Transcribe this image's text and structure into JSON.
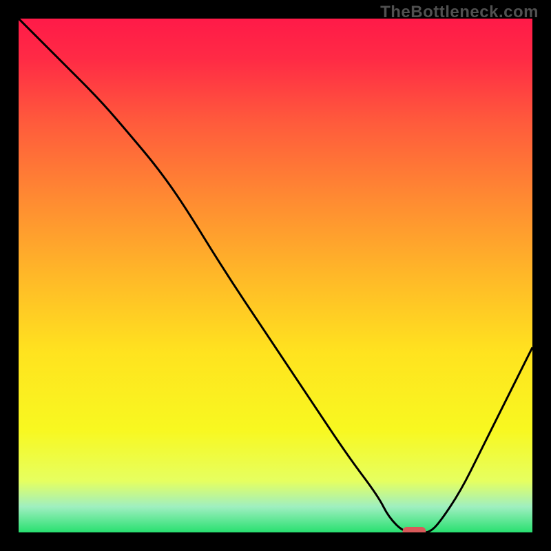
{
  "watermark": "TheBottleneck.com",
  "chart_data": {
    "type": "line",
    "curve": {
      "x": [
        0.0,
        0.08,
        0.16,
        0.22,
        0.27,
        0.32,
        0.4,
        0.48,
        0.56,
        0.64,
        0.7,
        0.72,
        0.75,
        0.78,
        0.8,
        0.82,
        0.86,
        0.9,
        0.94,
        1.0
      ],
      "y": [
        1.0,
        0.92,
        0.84,
        0.77,
        0.71,
        0.64,
        0.51,
        0.39,
        0.27,
        0.15,
        0.07,
        0.03,
        0.0,
        0.0,
        0.0,
        0.02,
        0.08,
        0.16,
        0.24,
        0.36
      ]
    },
    "marker": {
      "x": 0.77,
      "y": 0.0,
      "width": 0.045,
      "color": "#d85a5a"
    },
    "gradient_stops": [
      {
        "offset": 0.0,
        "color": "#ff1a48"
      },
      {
        "offset": 0.08,
        "color": "#ff2b45"
      },
      {
        "offset": 0.2,
        "color": "#ff5a3c"
      },
      {
        "offset": 0.35,
        "color": "#ff8a32"
      },
      {
        "offset": 0.5,
        "color": "#ffb828"
      },
      {
        "offset": 0.65,
        "color": "#ffe31f"
      },
      {
        "offset": 0.8,
        "color": "#f8f820"
      },
      {
        "offset": 0.9,
        "color": "#e6ff60"
      },
      {
        "offset": 0.95,
        "color": "#9fefc0"
      },
      {
        "offset": 1.0,
        "color": "#28e070"
      }
    ],
    "title": "",
    "xlabel": "",
    "ylabel": "",
    "xlim": [
      0,
      1
    ],
    "ylim": [
      0,
      1
    ]
  }
}
